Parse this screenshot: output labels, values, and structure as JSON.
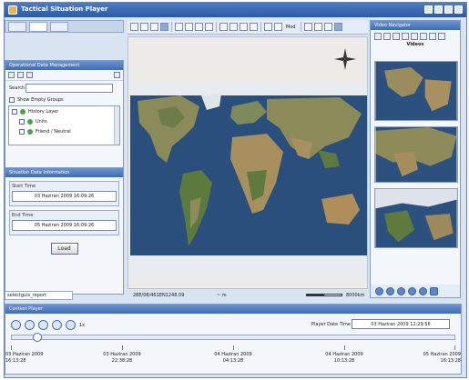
{
  "window": {
    "title": "Tactical Situation Player",
    "accent": "#3e6db6"
  },
  "left_panel": {
    "tabs": [
      "tab-1",
      "tab-2",
      "tab-3"
    ],
    "tree_section": {
      "heading": "Operational Data Management",
      "search_label": "Search",
      "search_value": "",
      "show_empty_groups": "Show Empty Groups",
      "layers": [
        {
          "label": "History Layer",
          "color": "#4aa34a"
        },
        {
          "label": "Units",
          "color": "#4aa34a"
        },
        {
          "label": "Friend / Neutral",
          "color": "#4aa34a"
        }
      ]
    },
    "time_section": {
      "heading": "Situation Data Information",
      "start_label": "Start Time",
      "start_value": "03 Haziran 2009 16:09:26",
      "end_label": "End Time",
      "end_value": "05 Haziran 2009 16:09:26",
      "load_label": "Load"
    },
    "status": "selectguis_report"
  },
  "toolbar": {
    "mode_label": "Mod"
  },
  "map": {
    "coordinate": "28E/08/461EN1248.09",
    "scale_value": "~ m",
    "scale_unit": "8000km"
  },
  "right_panel": {
    "heading": "Video Navigator",
    "videos_label": "Videos"
  },
  "player": {
    "heading": "Context Player",
    "speed": "1x",
    "time_label": "Player Date Time",
    "time_value": "03 Haziran 2009 12:29:56",
    "progress": 0.05,
    "ticks": [
      {
        "date": "03 Haziran 2009",
        "time": "16:13:28"
      },
      {
        "date": "03 Haziran 2009",
        "time": "22:38:28"
      },
      {
        "date": "04 Haziran 2009",
        "time": "04:13:28"
      },
      {
        "date": "04 Haziran 2009",
        "time": "10:13:28"
      },
      {
        "date": "05 Haziran 2009",
        "time": "16:13:28"
      }
    ]
  }
}
